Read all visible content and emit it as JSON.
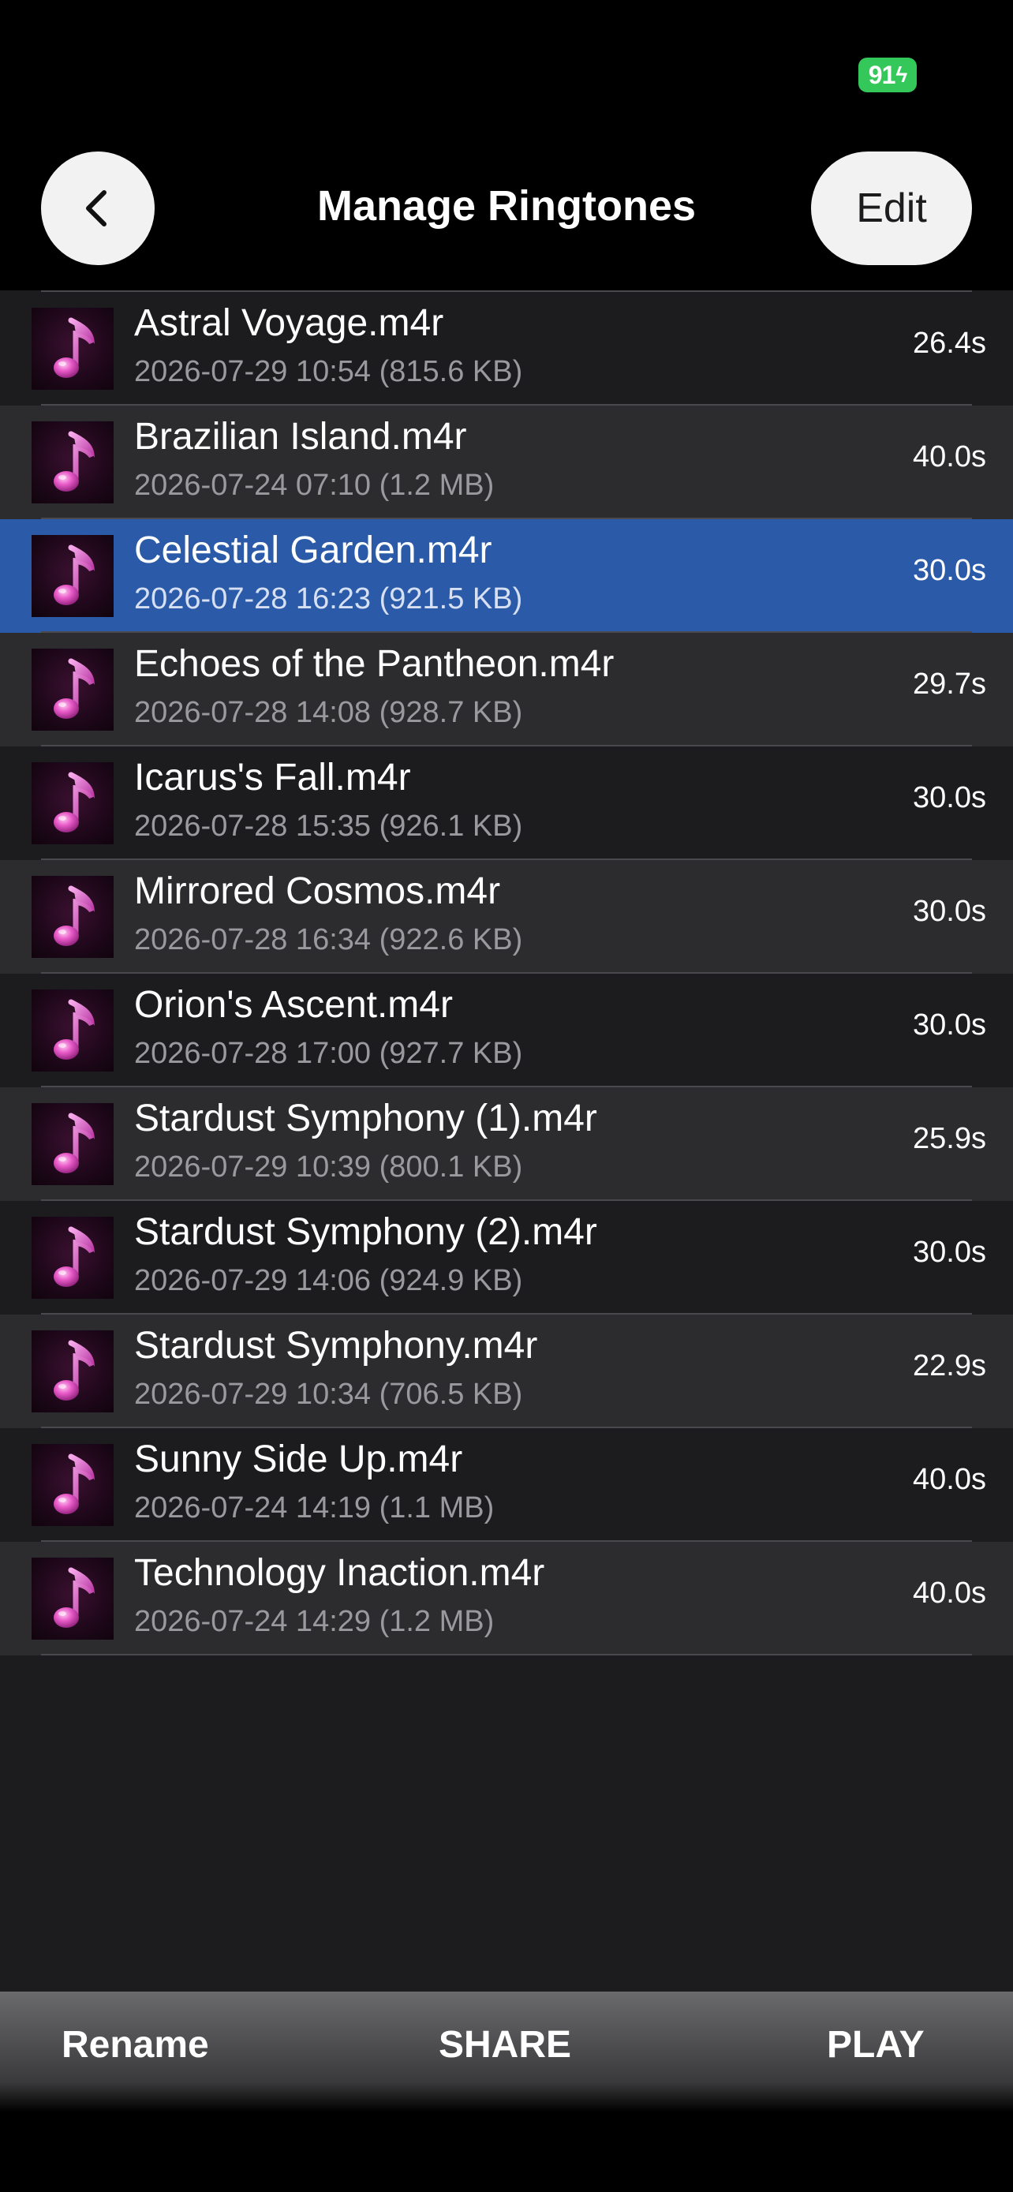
{
  "status_bar": {
    "battery_level": "91",
    "battery_color": "#34c759"
  },
  "nav": {
    "title": "Manage Ringtones",
    "edit_label": "Edit",
    "back_icon": "chevron-left-icon"
  },
  "list": {
    "selected_index": 2,
    "selected_color": "#2a5aa8",
    "thumb_icon": "music-note-icon",
    "items": [
      {
        "name": "Astral Voyage.m4r",
        "meta": "2026-07-29 10:54 (815.6 KB)",
        "duration": "26.4s"
      },
      {
        "name": "Brazilian Island.m4r",
        "meta": "2026-07-24 07:10 (1.2 MB)",
        "duration": "40.0s"
      },
      {
        "name": "Celestial Garden.m4r",
        "meta": "2026-07-28 16:23 (921.5 KB)",
        "duration": "30.0s"
      },
      {
        "name": "Echoes of the Pantheon.m4r",
        "meta": "2026-07-28 14:08 (928.7 KB)",
        "duration": "29.7s"
      },
      {
        "name": "Icarus's Fall.m4r",
        "meta": "2026-07-28 15:35 (926.1 KB)",
        "duration": "30.0s"
      },
      {
        "name": "Mirrored Cosmos.m4r",
        "meta": "2026-07-28 16:34 (922.6 KB)",
        "duration": "30.0s"
      },
      {
        "name": "Orion's Ascent.m4r",
        "meta": "2026-07-28 17:00 (927.7 KB)",
        "duration": "30.0s"
      },
      {
        "name": "Stardust Symphony (1).m4r",
        "meta": "2026-07-29 10:39 (800.1 KB)",
        "duration": "25.9s"
      },
      {
        "name": "Stardust Symphony (2).m4r",
        "meta": "2026-07-29 14:06 (924.9 KB)",
        "duration": "30.0s"
      },
      {
        "name": "Stardust Symphony.m4r",
        "meta": "2026-07-29 10:34 (706.5 KB)",
        "duration": "22.9s"
      },
      {
        "name": "Sunny Side Up.m4r",
        "meta": "2026-07-24 14:19 (1.1 MB)",
        "duration": "40.0s"
      },
      {
        "name": "Technology Inaction.m4r",
        "meta": "2026-07-24 14:29 (1.2 MB)",
        "duration": "40.0s"
      }
    ]
  },
  "toolbar": {
    "rename_label": "Rename",
    "share_label": "SHARE",
    "play_label": "PLAY"
  }
}
